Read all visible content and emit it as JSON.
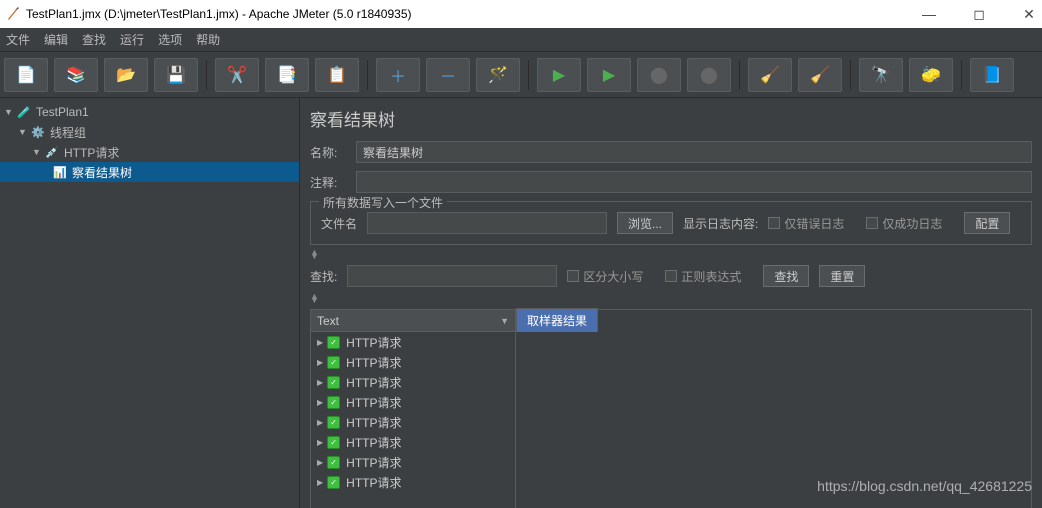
{
  "title": "TestPlan1.jmx (D:\\jmeter\\TestPlan1.jmx) - Apache JMeter (5.0 r1840935)",
  "menu": [
    "文件",
    "编辑",
    "查找",
    "运行",
    "选项",
    "帮助"
  ],
  "toolbar_icons": [
    "new-file",
    "templates",
    "open",
    "save",
    "cut",
    "copy",
    "paste",
    "plus",
    "minus",
    "wand",
    "play",
    "play-timer",
    "stop",
    "shutdown",
    "broom-sub",
    "broom",
    "binoculars",
    "fn",
    "toggle"
  ],
  "tree": {
    "root": "TestPlan1",
    "group": "线程组",
    "http": "HTTP请求",
    "listener": "察看结果树"
  },
  "panel": {
    "title": "察看结果树",
    "name_label": "名称:",
    "name_value": "察看结果树",
    "comment_label": "注释:",
    "file_legend": "所有数据写入一个文件",
    "filename_label": "文件名",
    "browse": "浏览...",
    "log_label": "显示日志内容:",
    "err_only": "仅错误日志",
    "ok_only": "仅成功日志",
    "config": "配置",
    "search_label": "查找:",
    "case": "区分大小写",
    "regex": "正则表达式",
    "search_btn": "查找",
    "reset_btn": "重置",
    "renderer": "Text",
    "tab_sampler": "取样器结果",
    "results": [
      "HTTP请求",
      "HTTP请求",
      "HTTP请求",
      "HTTP请求",
      "HTTP请求",
      "HTTP请求",
      "HTTP请求",
      "HTTP请求"
    ]
  },
  "watermark": "https://blog.csdn.net/qq_42681225"
}
